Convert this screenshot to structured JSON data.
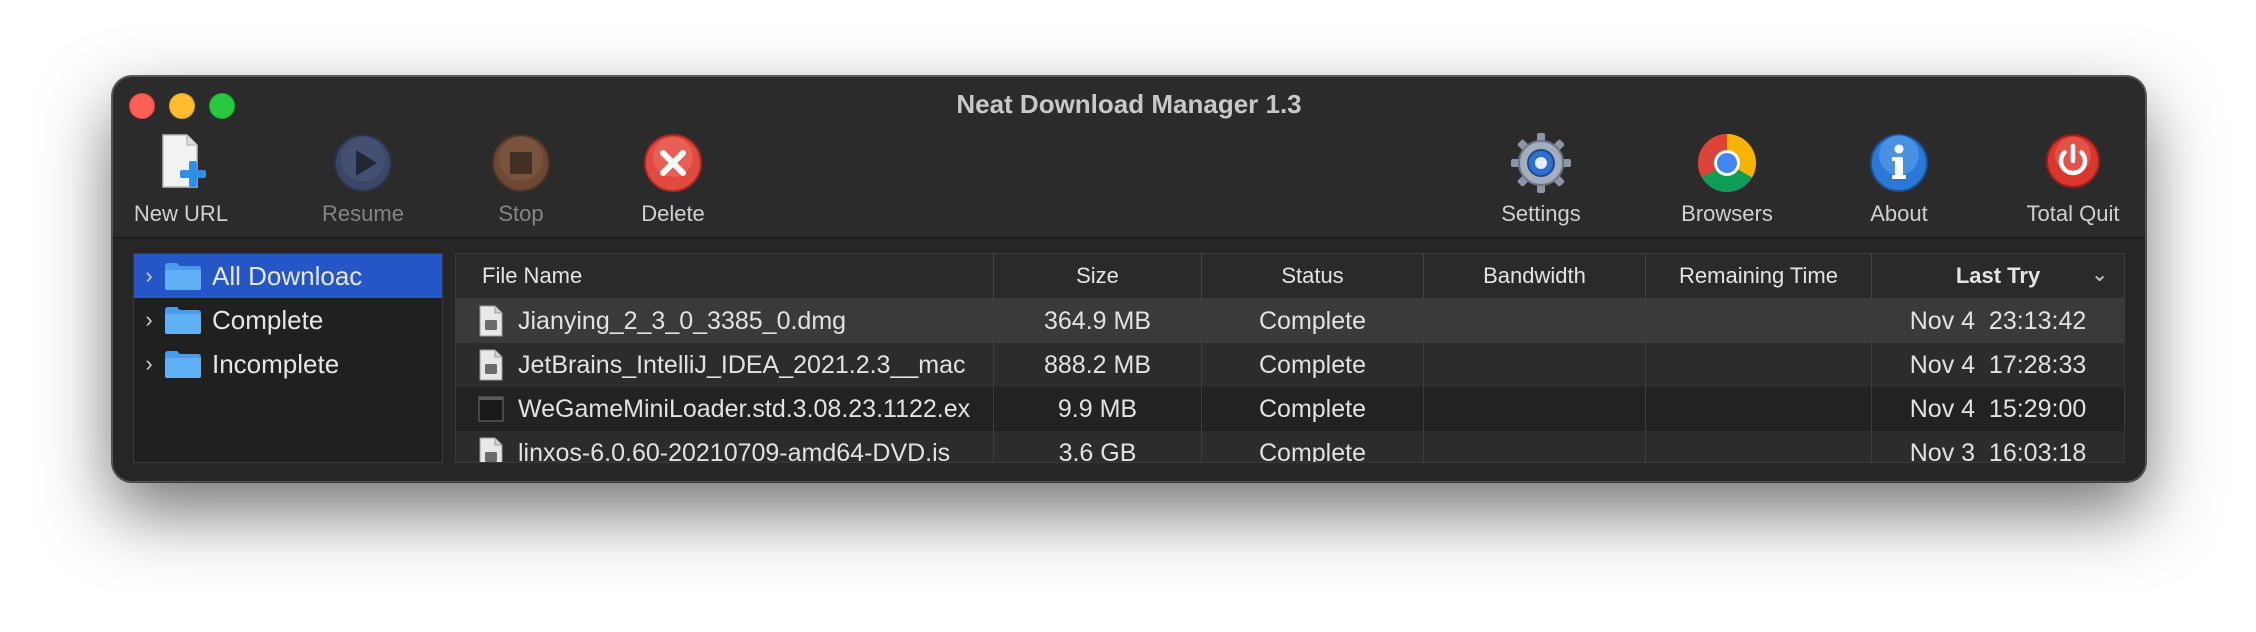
{
  "window": {
    "title": "Neat Download Manager 1.3"
  },
  "toolbar": {
    "new_url": "New URL",
    "resume": "Resume",
    "stop": "Stop",
    "delete": "Delete",
    "settings": "Settings",
    "browsers": "Browsers",
    "about": "About",
    "total_quit": "Total Quit"
  },
  "sidebar": {
    "items": [
      {
        "label": "All Downloac",
        "selected": true
      },
      {
        "label": "Complete",
        "selected": false
      },
      {
        "label": "Incomplete",
        "selected": false
      }
    ]
  },
  "table": {
    "columns": [
      "File Name",
      "Size",
      "Status",
      "Bandwidth",
      "Remaining Time",
      "Last Try"
    ],
    "sorted_column": "Last Try",
    "rows": [
      {
        "name": "Jianying_2_3_0_3385_0.dmg",
        "size": "364.9 MB",
        "status": "Complete",
        "bandwidth": "",
        "remaining": "",
        "last_try": "Nov 4  23:13:42",
        "icon": "document-icon"
      },
      {
        "name": "JetBrains_IntelliJ_IDEA_2021.2.3__mac",
        "size": "888.2 MB",
        "status": "Complete",
        "bandwidth": "",
        "remaining": "",
        "last_try": "Nov 4  17:28:33",
        "icon": "document-icon"
      },
      {
        "name": "WeGameMiniLoader.std.3.08.23.1122.ex",
        "size": "9.9 MB",
        "status": "Complete",
        "bandwidth": "",
        "remaining": "",
        "last_try": "Nov 4  15:29:00",
        "icon": "executable-icon"
      },
      {
        "name": "linxos-6.0.60-20210709-amd64-DVD.is",
        "size": "3.6 GB",
        "status": "Complete",
        "bandwidth": "",
        "remaining": "",
        "last_try": "Nov 3  16:03:18",
        "icon": "document-icon"
      }
    ]
  },
  "colors": {
    "window_bg": "#2b2b2b",
    "selection": "#2457c5",
    "delete_red": "#e04a3f",
    "about_blue": "#2a79d6",
    "quit_red": "#d9372e"
  }
}
